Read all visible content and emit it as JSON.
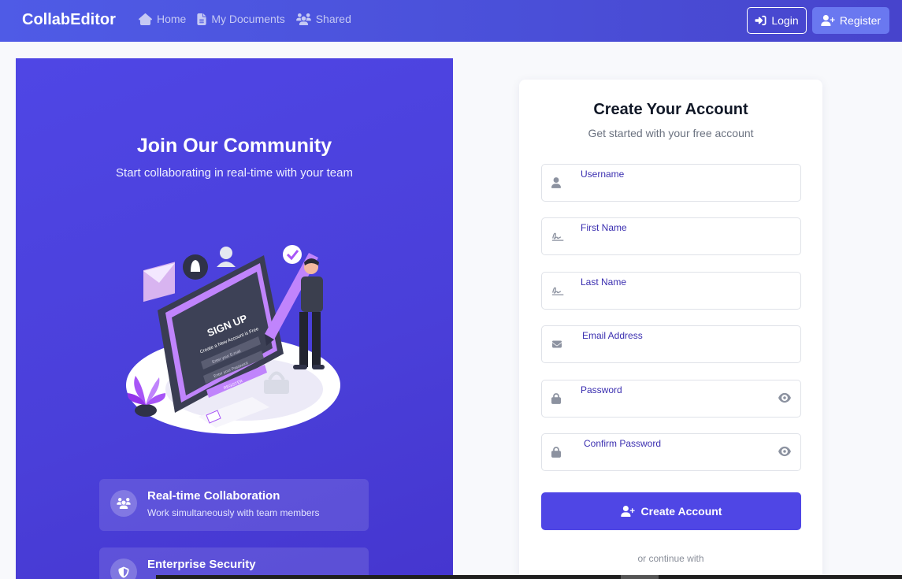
{
  "nav": {
    "brand": "CollabEditor",
    "links": [
      {
        "label": "Home",
        "icon": "home-icon"
      },
      {
        "label": "My Documents",
        "icon": "file-icon"
      },
      {
        "label": "Shared",
        "icon": "users-icon"
      }
    ],
    "login_label": "Login",
    "register_label": "Register"
  },
  "left": {
    "title": "Join Our Community",
    "subtitle": "Start collaborating in real-time with your team",
    "illustration_text": {
      "signup": "SIGN UP",
      "tagline": "Create a New Account is Free",
      "email": "Enter your E-mail",
      "password": "Enter your Password",
      "register": "REGISTER"
    },
    "features": [
      {
        "title": "Real-time Collaboration",
        "desc": "Work simultaneously with team members",
        "icon": "users-icon"
      },
      {
        "title": "Enterprise Security",
        "desc": "",
        "icon": "shield-icon"
      }
    ]
  },
  "form": {
    "title": "Create Your Account",
    "subtitle": "Get started with your free account",
    "fields": [
      {
        "label": "Username",
        "icon": "user-icon"
      },
      {
        "label": "First Name",
        "icon": "signature-icon"
      },
      {
        "label": "Last Name",
        "icon": "signature-icon"
      },
      {
        "label": "Email Address",
        "icon": "envelope-icon"
      },
      {
        "label": "Password",
        "icon": "lock-icon"
      },
      {
        "label": "Confirm Password",
        "icon": "lock-icon"
      }
    ],
    "submit_label": "Create Account",
    "alt_text": "or continue with"
  },
  "colors": {
    "primary": "#4f46e5",
    "navbar": "#4a4fd8",
    "label": "#3b2fb0"
  }
}
